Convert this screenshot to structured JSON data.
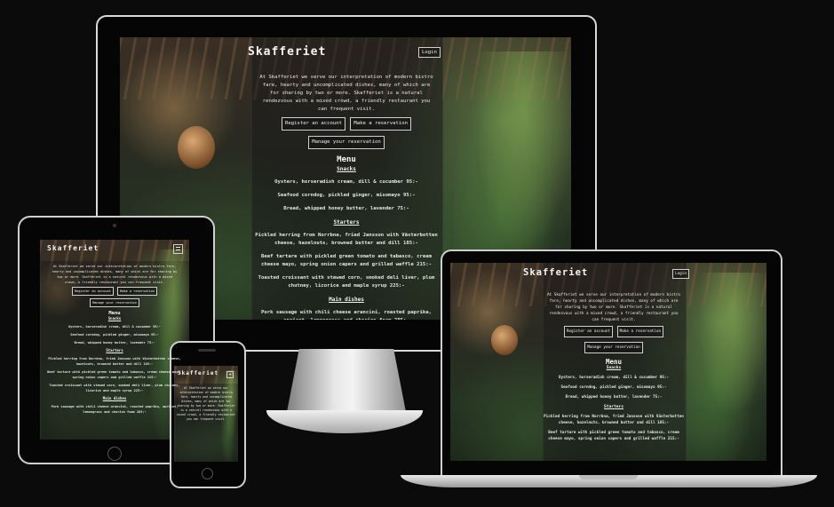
{
  "site": {
    "brand": "Skafferiet",
    "login_label": "Login",
    "intro": "At Skafferiet we serve our interpretation of modern bistro fare, hearty and uncomplicated dishes, many of which are for sharing by two or more. Skafferiet is a natural rendezvous with a mixed crowd, a friendly restaurant you can frequent visit.",
    "buttons": {
      "register": "Register an account",
      "reservation": "Make a reservation",
      "manage": "Manage your reservation"
    },
    "menu": {
      "title": "Menu",
      "snacks": {
        "title": "Snacks",
        "items": [
          "Oysters, horseradish cream, dill & cucumber 95:-",
          "Seafood corndog, pickled ginger, misomayo 95:-",
          "Bread, whipped honey butter, lavender 75:-"
        ]
      },
      "starters": {
        "title": "Starters",
        "items": [
          "Pickled herring from Norrbna, fried Jansson with Västerbotten cheese, hazelnuts, browned butter and dill 185:-",
          "Beef tartare with pickled green tomato and tabasco, cream cheese mayo, spring onion capers and grilled waffle 215:-",
          "Toasted croissant with stewed corn, smoked deli liver, plum chutney, licorice and maple syrup 225:-"
        ]
      },
      "mains": {
        "title": "Main dishes",
        "items": [
          "Pork sausage with chili cheese arancini, roasted paprika, apricot, lemongrass and chorizo foam 285:-"
        ]
      }
    }
  }
}
